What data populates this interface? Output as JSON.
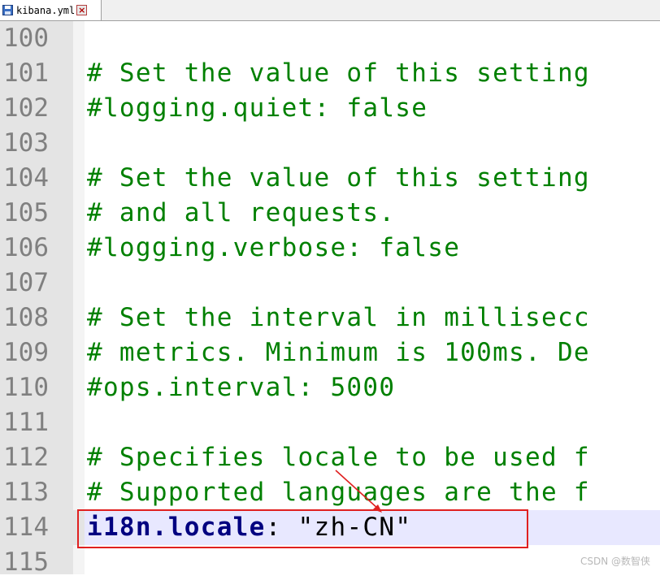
{
  "tab": {
    "filename": "kibana.yml",
    "close_glyph": "×"
  },
  "lines": [
    {
      "number": "100",
      "text": "",
      "kind": "plain"
    },
    {
      "number": "101",
      "text": "# Set the value of this setting",
      "kind": "comment"
    },
    {
      "number": "102",
      "text": "#logging.quiet: false",
      "kind": "comment"
    },
    {
      "number": "103",
      "text": "",
      "kind": "plain"
    },
    {
      "number": "104",
      "text": "# Set the value of this setting",
      "kind": "comment"
    },
    {
      "number": "105",
      "text": "# and all requests.",
      "kind": "comment"
    },
    {
      "number": "106",
      "text": "#logging.verbose: false",
      "kind": "comment"
    },
    {
      "number": "107",
      "text": "",
      "kind": "plain"
    },
    {
      "number": "108",
      "text": "# Set the interval in millisecc",
      "kind": "comment"
    },
    {
      "number": "109",
      "text": "# metrics. Minimum is 100ms. De",
      "kind": "comment"
    },
    {
      "number": "110",
      "text": "#ops.interval: 5000",
      "kind": "comment"
    },
    {
      "number": "111",
      "text": "",
      "kind": "plain"
    },
    {
      "number": "112",
      "text": "# Specifies locale to be used f",
      "kind": "comment"
    },
    {
      "number": "113",
      "text": "# Supported languages are the f",
      "kind": "comment"
    },
    {
      "number": "114",
      "key": "i18n.locale",
      "sep": ": ",
      "value": "\"zh-CN\"",
      "kind": "key-value",
      "current": true
    },
    {
      "number": "115",
      "text": "",
      "kind": "plain"
    }
  ],
  "watermark": "CSDN @数智侠",
  "colors": {
    "comment": "#008000",
    "key": "#000080",
    "current_line": "#e8e8ff",
    "annotation": "#e02020"
  }
}
